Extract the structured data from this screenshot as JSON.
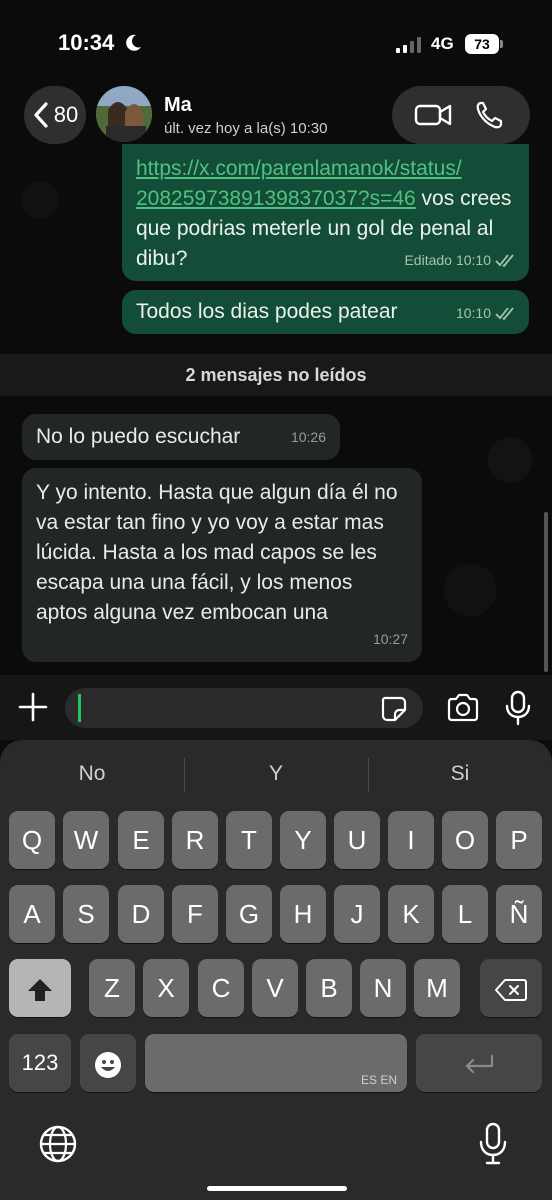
{
  "status_bar": {
    "time": "10:34",
    "network": "4G",
    "battery": "73"
  },
  "header": {
    "back_count": "80",
    "contact_name": "Ma",
    "last_seen": "últ. vez hoy a la(s) 10:30"
  },
  "messages": {
    "m1": {
      "link": "https://x.com/parenlamanok/status/2082597389139837037?s=46",
      "link_line1": "https://x.com/parenlamanok/status/",
      "link_line2": "2082597389139837037?s=46",
      "text_after_link": " vos crees que podrias meterle un gol de penal al dibu?",
      "edited": "Editado",
      "time": "10:10"
    },
    "m2": {
      "text": "Todos los dias podes patear",
      "time": "10:10"
    },
    "unread_banner": "2 mensajes no leídos",
    "m3": {
      "text": "No lo puedo escuchar",
      "time": "10:26"
    },
    "m4": {
      "text": "Y yo intento. Hasta que algun día él no va estar tan fino y yo voy a estar mas lúcida. Hasta a los mad capos se les escapa una una fácil,  y los menos aptos alguna vez embocan una",
      "time": "10:27"
    }
  },
  "composer": {
    "value": ""
  },
  "keyboard": {
    "suggestions": [
      "No",
      "Y",
      "Si"
    ],
    "row1": [
      "Q",
      "W",
      "E",
      "R",
      "T",
      "Y",
      "U",
      "I",
      "O",
      "P"
    ],
    "row2": [
      "A",
      "S",
      "D",
      "F",
      "G",
      "H",
      "J",
      "K",
      "L",
      "Ñ"
    ],
    "row3": [
      "Z",
      "X",
      "C",
      "V",
      "B",
      "N",
      "M"
    ],
    "numbers_key": "123",
    "space_languages": "ES EN"
  },
  "icons": {
    "back": "chevron-left-icon",
    "video": "video-icon",
    "phone": "phone-icon",
    "plus": "plus-icon",
    "sticker": "sticker-icon",
    "camera": "camera-icon",
    "mic": "mic-icon",
    "shift": "shift-icon",
    "delete": "delete-icon",
    "emoji": "emoji-icon",
    "return": "return-icon",
    "globe": "globe-icon"
  },
  "colors": {
    "outgoing_bubble": "#144d37",
    "incoming_bubble": "#232626",
    "link": "#4fc27f",
    "caret": "#1fc463"
  }
}
